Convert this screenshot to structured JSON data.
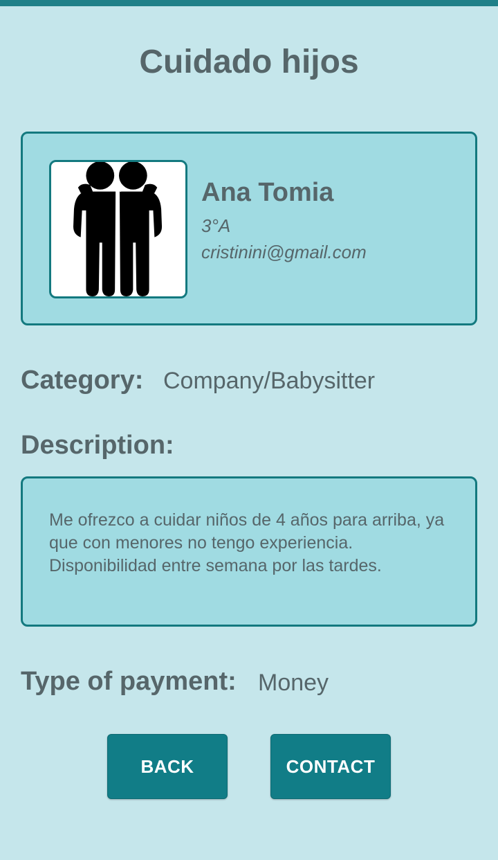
{
  "header": {
    "title": "Cuidado hijos"
  },
  "profile": {
    "name": "Ana Tomia",
    "apartment": "3°A",
    "email": "cristinini@gmail.com",
    "avatar_icon": "two-people-icon"
  },
  "details": {
    "category_label": "Category:",
    "category_value": "Company/Babysitter",
    "description_label": "Description:",
    "description_text": "Me ofrezco a cuidar niños de 4 años para arriba, ya que con menores no tengo experiencia. Disponibilidad entre semana por las tardes.",
    "payment_label": "Type of payment:",
    "payment_value": "Money"
  },
  "actions": {
    "back_label": "BACK",
    "contact_label": "CONTACT"
  },
  "colors": {
    "background": "#c5e6eb",
    "card": "#a0dbe2",
    "accent": "#13797f",
    "button": "#117d87",
    "text": "#56666a"
  }
}
